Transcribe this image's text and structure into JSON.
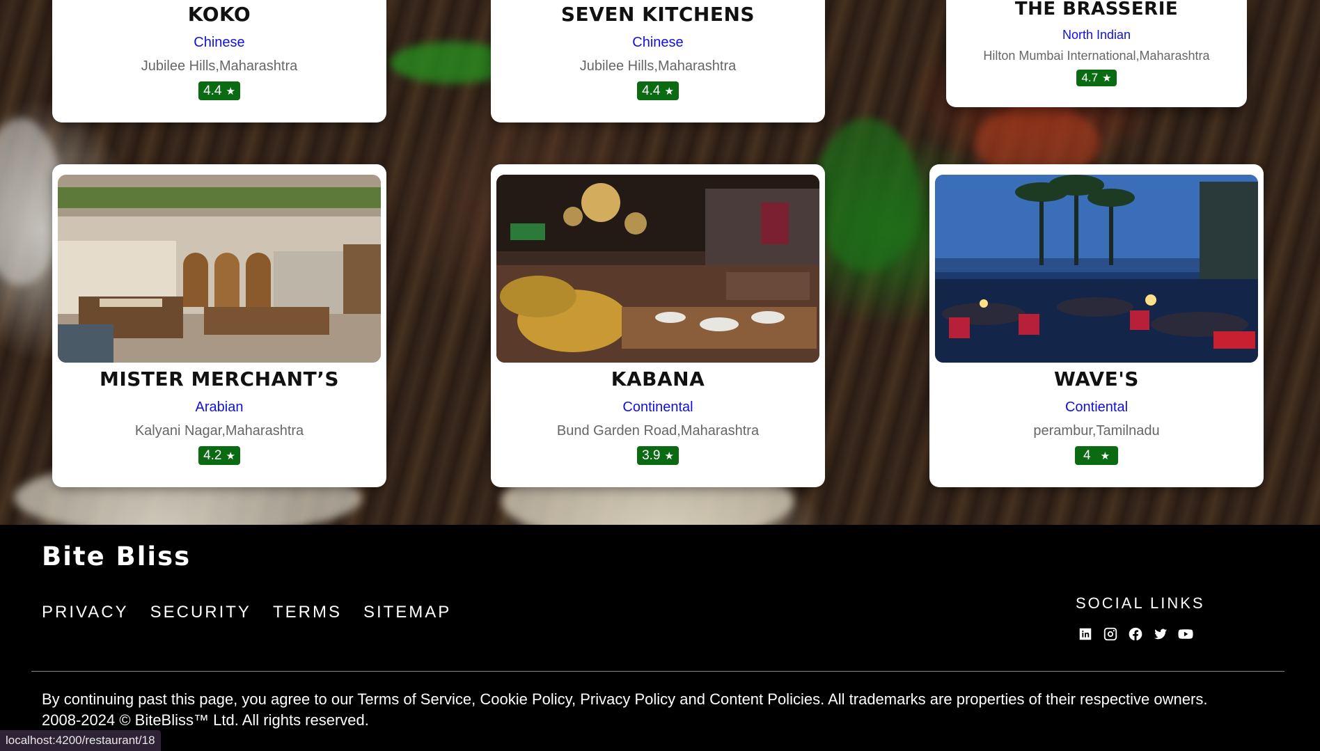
{
  "restaurants_top": [
    {
      "name": "KOKO",
      "cuisine": "Chinese",
      "location": "Jubilee Hills,Maharashtra",
      "rating": "4.4"
    },
    {
      "name": "SEVEN KITCHENS",
      "cuisine": "Chinese",
      "location": "Jubilee Hills,Maharashtra",
      "rating": "4.4"
    },
    {
      "name": "THE BRASSERIE",
      "cuisine": "North Indian",
      "location": "Hilton Mumbai International,Maharashtra",
      "rating": "4.7"
    }
  ],
  "restaurants_bottom": [
    {
      "name": "MISTER MERCHANT’S",
      "cuisine": "Arabian",
      "location": "Kalyani Nagar,Maharashtra",
      "rating": "4.2"
    },
    {
      "name": "KABANA",
      "cuisine": "Continental",
      "location": "Bund Garden Road,Maharashtra",
      "rating": "3.9"
    },
    {
      "name": "WAVE'S",
      "cuisine": "Contiental",
      "location": "perambur,Tamilnadu",
      "rating": "4"
    }
  ],
  "colors": {
    "rating_badge": "#0a6b12",
    "cuisine_text": "#1010dd",
    "footer_bg": "#000000"
  },
  "footer": {
    "brand": "Bite Bliss",
    "links": [
      "PRIVACY",
      "SECURITY",
      "TERMS",
      "SITEMAP"
    ],
    "social_title": "SOCIAL LINKS",
    "social_icons": [
      "linkedin-icon",
      "instagram-icon",
      "facebook-icon",
      "twitter-icon",
      "youtube-icon"
    ],
    "legal_line1": "By continuing past this page, you agree to our Terms of Service, Cookie Policy, Privacy Policy and Content Policies. All trademarks are properties of their respective owners.",
    "legal_line2": "2008-2024 © BiteBliss™ Ltd. All rights reserved."
  },
  "status_url": "localhost:4200/restaurant/18"
}
